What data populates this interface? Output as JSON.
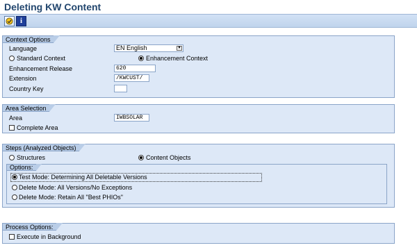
{
  "window": {
    "title": "Deleting KW Content"
  },
  "toolbar": {
    "execute_icon": "execute-icon",
    "info_icon": "info-icon",
    "info_glyph": "i"
  },
  "context_options": {
    "title": "Context Options",
    "language_label": "Language",
    "language_value": "EN English",
    "standard_context_label": "Standard Context",
    "enhancement_context_label": "Enhancement Context",
    "enhancement_context_selected": true,
    "enhancement_release_label": "Enhancement Release",
    "enhancement_release_value": "620",
    "extension_label": "Extension",
    "extension_value": "/KWCUST/",
    "country_key_label": "Country Key",
    "country_key_value": ""
  },
  "area_selection": {
    "title": "Area Selection",
    "area_label": "Area",
    "area_value": "IWBSOLAR",
    "complete_area_label": "Complete Area",
    "complete_area_checked": false
  },
  "steps": {
    "title": "Steps (Analyzed Objects)",
    "structures_label": "Structures",
    "content_objects_label": "Content Objects",
    "content_objects_selected": true,
    "options": {
      "title": "Options:",
      "test_mode_label": "Test Mode: Determining All Deletable Versions",
      "delete_all_label": "Delete Mode: All Versions/No Exceptions",
      "delete_retain_label": "Delete Mode: Retain All \"Best PHIOs\"",
      "selected": "test_mode"
    }
  },
  "process_options": {
    "title": "Process Options:",
    "background_label": "Execute in Background",
    "background_checked": false
  },
  "colors": {
    "title": "#22466e",
    "panel_bg": "#dde8f7",
    "panel_border": "#8aa4c8",
    "tab_bg": "#b9cde7"
  }
}
